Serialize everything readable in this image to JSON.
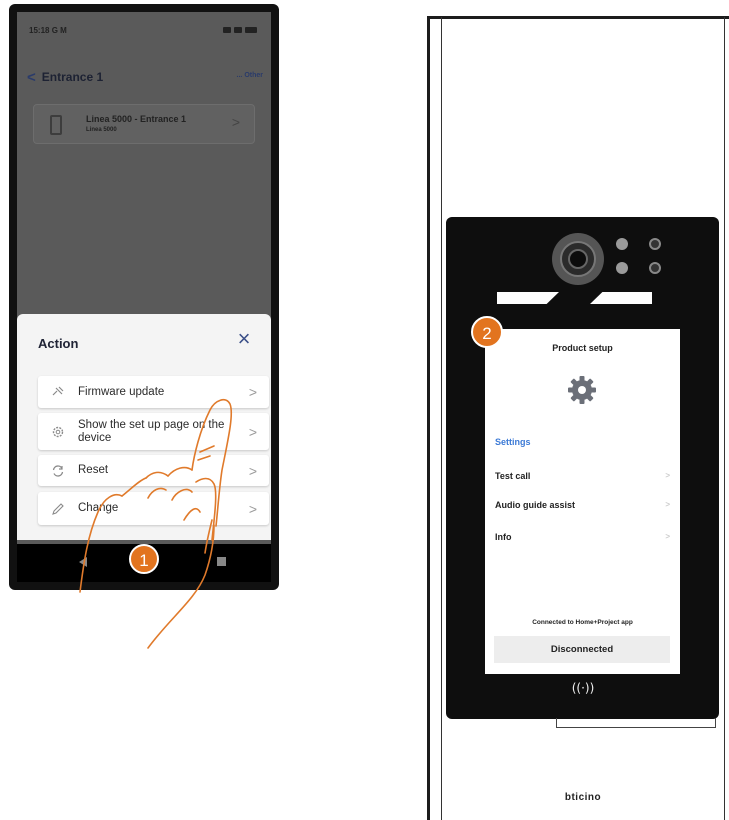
{
  "phone": {
    "status_bar": {
      "time": "15:18",
      "left_icons": "G M"
    },
    "header": {
      "back": "<",
      "title": "Entrance 1",
      "other": "... Other"
    },
    "device_card": {
      "name": "Linea 5000 - Entrance 1",
      "subtitle": "Linea 5000",
      "chevron": ">"
    },
    "action_sheet": {
      "title": "Action",
      "close": "×",
      "items": [
        {
          "label": "Firmware update",
          "icon": "firmware-icon",
          "chevron": ">"
        },
        {
          "label": "Show the set up page on the device",
          "icon": "gear-icon",
          "chevron": ">"
        },
        {
          "label": "Reset",
          "icon": "reset-icon",
          "chevron": ">"
        },
        {
          "label": "Change",
          "icon": "pencil-icon",
          "chevron": ">"
        }
      ]
    }
  },
  "steps": {
    "step1": "1",
    "step2": "2"
  },
  "panel": {
    "screen": {
      "title": "Product setup",
      "section": "Settings",
      "rows": [
        {
          "label": "Test call",
          "chevron": ">"
        },
        {
          "label": "Audio guide assist",
          "chevron": ">"
        },
        {
          "label": "Info",
          "chevron": ">"
        }
      ],
      "connected_text": "Connected to Home+Project app",
      "status_button": "Disconnected"
    },
    "nfc_symbol": "((·))",
    "brand": "bticino"
  },
  "colors": {
    "accent_orange": "#e2741f",
    "link_blue": "#3c7ad6",
    "dark_navy": "#2a3b6a"
  }
}
